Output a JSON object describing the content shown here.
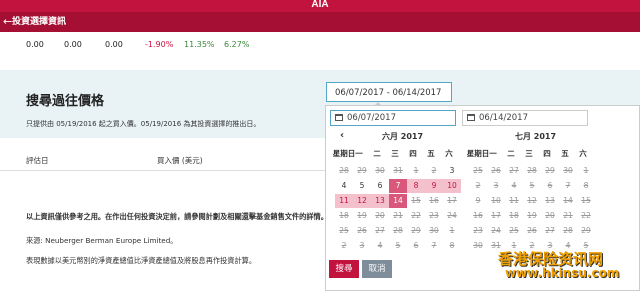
{
  "app": {
    "brand": "AIA",
    "back_glyph": "←",
    "page_title": "投資選擇資訊"
  },
  "performance_row": [
    "0.00",
    "0.00",
    "0.00",
    "-1.90%",
    "11.35%",
    "6.27%"
  ],
  "colors": {
    "negative": "#d0123f",
    "positive": "#3a8a3a",
    "brand": "#c2133f"
  },
  "search": {
    "title": "搜尋過往價格",
    "note": "只提供由 05/19/2016 起之買入價。05/19/2016 為其投資選擇的推出日。",
    "range_value": "06/07/2017 - 06/14/2017"
  },
  "table": {
    "col_date": "評估日",
    "col_price": "買入價 (美元)"
  },
  "disclaimer": "以上資訊僅供參考之用。在作出任何投資決定前，請參閱計劃及相關還擊基金銷售文件的詳情。",
  "source": "來源: Neuberger Berman Europe Limited。",
  "note2": "表現數據以美元幣別的淨資產總值比淨資產總值及將股息再作投資計算。",
  "picker": {
    "start_value": "06/07/2017",
    "end_value": "06/14/2017",
    "prev_icon": "chevron-left-icon",
    "weekdays": [
      "星期日",
      "一",
      "二",
      "三",
      "四",
      "五",
      "六"
    ],
    "left": {
      "title": "六月 2017",
      "weeks": [
        [
          {
            "d": "28",
            "s": "dis"
          },
          {
            "d": "29",
            "s": "dis"
          },
          {
            "d": "30",
            "s": "dis"
          },
          {
            "d": "31",
            "s": "dis"
          },
          {
            "d": "1",
            "s": "dis"
          },
          {
            "d": "2",
            "s": "dis"
          },
          {
            "d": "3",
            "s": ""
          }
        ],
        [
          {
            "d": "4",
            "s": ""
          },
          {
            "d": "5",
            "s": ""
          },
          {
            "d": "6",
            "s": ""
          },
          {
            "d": "7",
            "s": "sel"
          },
          {
            "d": "8",
            "s": "inr"
          },
          {
            "d": "9",
            "s": "inr"
          },
          {
            "d": "10",
            "s": "inr"
          }
        ],
        [
          {
            "d": "11",
            "s": "inr"
          },
          {
            "d": "12",
            "s": "inr"
          },
          {
            "d": "13",
            "s": "inr"
          },
          {
            "d": "14",
            "s": "sel"
          },
          {
            "d": "15",
            "s": "dis"
          },
          {
            "d": "16",
            "s": "dis"
          },
          {
            "d": "17",
            "s": "dis"
          }
        ],
        [
          {
            "d": "18",
            "s": "dis"
          },
          {
            "d": "19",
            "s": "dis"
          },
          {
            "d": "20",
            "s": "dis"
          },
          {
            "d": "21",
            "s": "dis"
          },
          {
            "d": "22",
            "s": "dis"
          },
          {
            "d": "23",
            "s": "dis"
          },
          {
            "d": "24",
            "s": "dis"
          }
        ],
        [
          {
            "d": "25",
            "s": "dis"
          },
          {
            "d": "26",
            "s": "dis"
          },
          {
            "d": "27",
            "s": "dis"
          },
          {
            "d": "28",
            "s": "dis"
          },
          {
            "d": "29",
            "s": "dis"
          },
          {
            "d": "30",
            "s": "dis"
          },
          {
            "d": "1",
            "s": "dis"
          }
        ],
        [
          {
            "d": "2",
            "s": "dis"
          },
          {
            "d": "3",
            "s": "dis"
          },
          {
            "d": "4",
            "s": "dis"
          },
          {
            "d": "5",
            "s": "dis"
          },
          {
            "d": "6",
            "s": "dis"
          },
          {
            "d": "7",
            "s": "dis"
          },
          {
            "d": "8",
            "s": "dis"
          }
        ]
      ]
    },
    "right": {
      "title": "七月 2017",
      "weeks": [
        [
          {
            "d": "25",
            "s": "dis"
          },
          {
            "d": "26",
            "s": "dis"
          },
          {
            "d": "27",
            "s": "dis"
          },
          {
            "d": "28",
            "s": "dis"
          },
          {
            "d": "29",
            "s": "dis"
          },
          {
            "d": "30",
            "s": "dis"
          },
          {
            "d": "1",
            "s": "dis"
          }
        ],
        [
          {
            "d": "2",
            "s": "dis"
          },
          {
            "d": "3",
            "s": "dis"
          },
          {
            "d": "4",
            "s": "dis"
          },
          {
            "d": "5",
            "s": "dis"
          },
          {
            "d": "6",
            "s": "dis"
          },
          {
            "d": "7",
            "s": "dis"
          },
          {
            "d": "8",
            "s": "dis"
          }
        ],
        [
          {
            "d": "9",
            "s": "dis"
          },
          {
            "d": "10",
            "s": "dis"
          },
          {
            "d": "11",
            "s": "dis"
          },
          {
            "d": "12",
            "s": "dis"
          },
          {
            "d": "13",
            "s": "dis"
          },
          {
            "d": "14",
            "s": "dis"
          },
          {
            "d": "15",
            "s": "dis"
          }
        ],
        [
          {
            "d": "16",
            "s": "dis"
          },
          {
            "d": "17",
            "s": "dis"
          },
          {
            "d": "18",
            "s": "dis"
          },
          {
            "d": "19",
            "s": "dis"
          },
          {
            "d": "20",
            "s": "dis"
          },
          {
            "d": "21",
            "s": "dis"
          },
          {
            "d": "22",
            "s": "dis"
          }
        ],
        [
          {
            "d": "23",
            "s": "dis"
          },
          {
            "d": "24",
            "s": "dis"
          },
          {
            "d": "25",
            "s": "dis"
          },
          {
            "d": "26",
            "s": "dis"
          },
          {
            "d": "27",
            "s": "dis"
          },
          {
            "d": "28",
            "s": "dis"
          },
          {
            "d": "29",
            "s": "dis"
          }
        ],
        [
          {
            "d": "30",
            "s": "dis"
          },
          {
            "d": "31",
            "s": "dis"
          },
          {
            "d": "1",
            "s": "dis"
          },
          {
            "d": "2",
            "s": "dis"
          },
          {
            "d": "3",
            "s": "dis"
          },
          {
            "d": "4",
            "s": "dis"
          },
          {
            "d": "5",
            "s": "dis"
          }
        ]
      ]
    },
    "search_label": "搜尋",
    "cancel_label": "取消"
  },
  "watermark": {
    "line1": "香港保险资讯网",
    "line2": "www.hkinsu.com"
  }
}
